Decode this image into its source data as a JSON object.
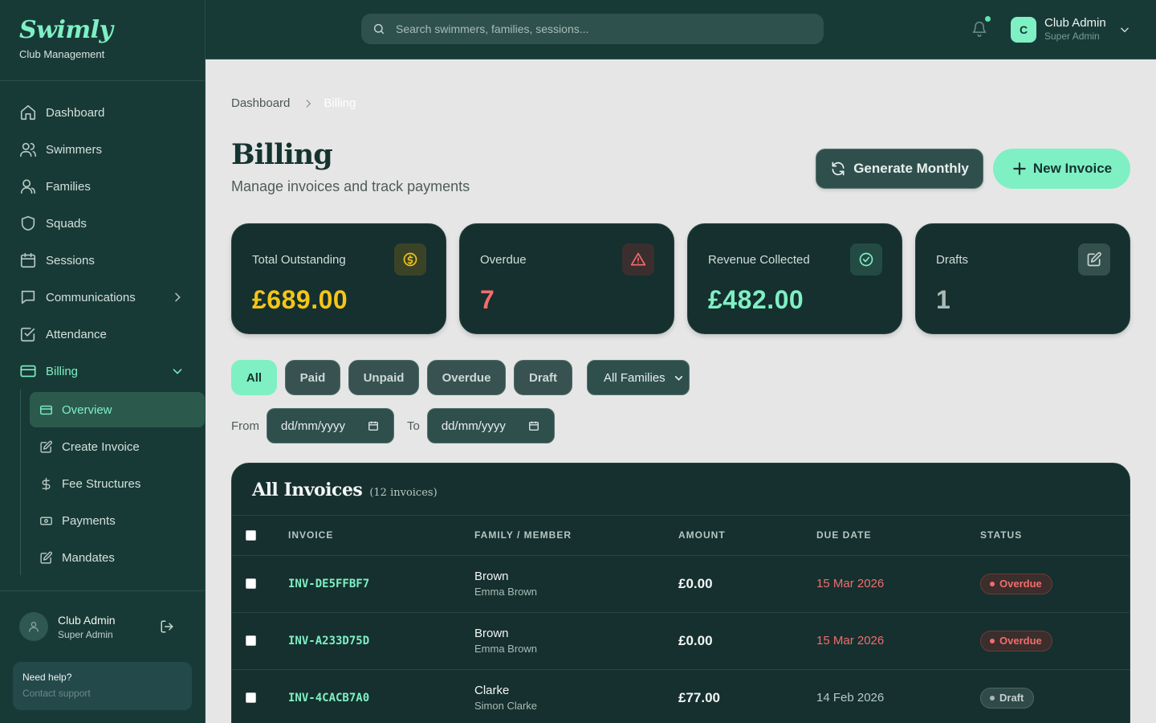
{
  "brand": {
    "name": "Swimly",
    "tagline": "Club Management"
  },
  "nav": {
    "items": [
      {
        "label": "Dashboard",
        "icon": "home-icon"
      },
      {
        "label": "Swimmers",
        "icon": "users-icon"
      },
      {
        "label": "Families",
        "icon": "family-icon"
      },
      {
        "label": "Squads",
        "icon": "shield-icon"
      },
      {
        "label": "Sessions",
        "icon": "calendar-icon"
      },
      {
        "label": "Communications",
        "icon": "message-icon"
      },
      {
        "label": "Attendance",
        "icon": "check-square-icon"
      },
      {
        "label": "Billing",
        "icon": "credit-card-icon"
      }
    ],
    "billing_sub": [
      {
        "label": "Overview",
        "icon": "card-icon"
      },
      {
        "label": "Create Invoice",
        "icon": "edit-icon"
      },
      {
        "label": "Fee Structures",
        "icon": "dollar-icon"
      },
      {
        "label": "Payments",
        "icon": "cash-icon"
      },
      {
        "label": "Mandates",
        "icon": "edit-icon"
      }
    ]
  },
  "sidebar_user": {
    "name": "Club Admin",
    "role": "Super Admin"
  },
  "help": {
    "title": "Need help?",
    "link": "Contact support"
  },
  "topbar": {
    "search_placeholder": "Search swimmers, families, sessions...",
    "user_initial": "C",
    "user_name": "Club Admin",
    "user_role": "Super Admin"
  },
  "breadcrumb": {
    "parent": "Dashboard",
    "current": "Billing"
  },
  "page": {
    "title": "Billing",
    "subtitle": "Manage invoices and track payments"
  },
  "actions": {
    "generate": "Generate Monthly",
    "new_invoice": "New Invoice"
  },
  "stats": [
    {
      "label": "Total Outstanding",
      "value": "£689.00",
      "color": "#f5c518",
      "icon": "dollar-circle-icon"
    },
    {
      "label": "Overdue",
      "value": "7",
      "color": "#f26d6d",
      "icon": "alert-triangle-icon"
    },
    {
      "label": "Revenue Collected",
      "value": "£482.00",
      "color": "#7ff0c4",
      "icon": "check-circle-icon"
    },
    {
      "label": "Drafts",
      "value": "1",
      "color": "#a9bab6",
      "icon": "edit-square-icon"
    }
  ],
  "filters": {
    "chips": [
      "All",
      "Paid",
      "Unpaid",
      "Overdue",
      "Draft"
    ],
    "active": "All",
    "family_select": "All Families",
    "from_label": "From",
    "to_label": "To",
    "date_placeholder": "dd/mm/yyyy"
  },
  "table": {
    "title": "All Invoices",
    "count": "(12 invoices)",
    "columns": [
      "INVOICE",
      "FAMILY / MEMBER",
      "AMOUNT",
      "DUE DATE",
      "STATUS"
    ],
    "rows": [
      {
        "id": "INV-DE5FFBF7",
        "family": "Brown",
        "member": "Emma Brown",
        "amount": "£0.00",
        "due": "15 Mar 2026",
        "status": "Overdue"
      },
      {
        "id": "INV-A233D75D",
        "family": "Brown",
        "member": "Emma Brown",
        "amount": "£0.00",
        "due": "15 Mar 2026",
        "status": "Overdue"
      },
      {
        "id": "INV-4CACB7A0",
        "family": "Clarke",
        "member": "Simon Clarke",
        "amount": "£77.00",
        "due": "14 Feb 2026",
        "status": "Draft"
      }
    ]
  },
  "colors": {
    "accent": "#7ff0c4",
    "sidebar": "#183a36",
    "overdue": "#f26d6d"
  }
}
